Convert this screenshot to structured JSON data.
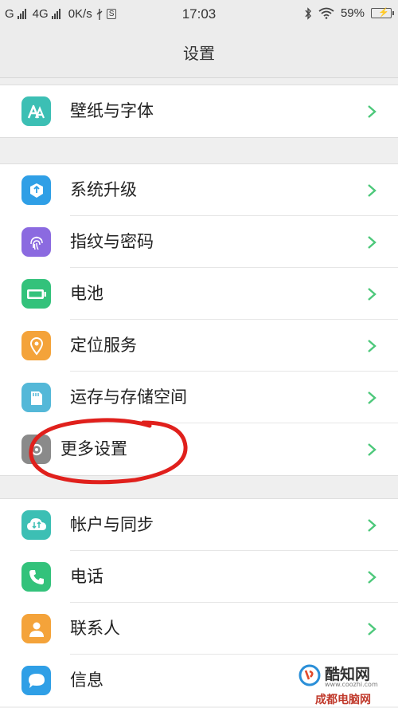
{
  "status_bar": {
    "carrier_1": "G",
    "carrier_2": "4G",
    "speed": "0K/s",
    "sim_badge": "S",
    "time": "17:03",
    "battery": "59%",
    "icons": [
      "signal-icon",
      "usb-icon",
      "bluetooth-icon",
      "wifi-icon",
      "battery-icon"
    ]
  },
  "header": {
    "title": "设置"
  },
  "groups": [
    {
      "items": [
        {
          "label": "壁纸与字体",
          "icon": "wallpaper-font-icon",
          "color": "#3cbfb4"
        }
      ]
    },
    {
      "items": [
        {
          "label": "系统升级",
          "icon": "system-update-icon",
          "color": "#2f9fe6"
        },
        {
          "label": "指纹与密码",
          "icon": "fingerprint-icon",
          "color": "#8b6ae0"
        },
        {
          "label": "电池",
          "icon": "battery-icon",
          "color": "#33c27b"
        },
        {
          "label": "定位服务",
          "icon": "location-icon",
          "color": "#f4a33a"
        },
        {
          "label": "运存与存储空间",
          "icon": "storage-icon",
          "color": "#54b8d8"
        },
        {
          "label": "更多设置",
          "icon": "more-settings-icon",
          "color": "#8a8a8a"
        }
      ]
    },
    {
      "items": [
        {
          "label": "帐户与同步",
          "icon": "account-sync-icon",
          "color": "#3cbfb4"
        },
        {
          "label": "电话",
          "icon": "phone-icon",
          "color": "#33c27b"
        },
        {
          "label": "联系人",
          "icon": "contacts-icon",
          "color": "#f4a33a"
        },
        {
          "label": "信息",
          "icon": "message-icon",
          "color": "#2f9fe6"
        }
      ]
    }
  ],
  "watermark": {
    "brand": "酷知网",
    "url": "www.coozhi.com",
    "sub": "成都电脑网"
  }
}
